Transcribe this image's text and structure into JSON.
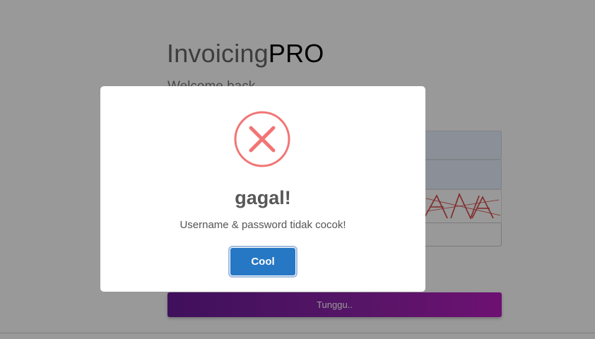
{
  "brand": {
    "prefix": "Invoicing",
    "suffix": "PRO"
  },
  "welcome": "Welcome back",
  "submit_label": "Tunggu..",
  "modal": {
    "icon": "error-x-icon",
    "title": "gagal!",
    "message": "Username & password tidak cocok!",
    "confirm_label": "Cool"
  },
  "colors": {
    "error_red": "#f27474",
    "confirm_blue": "#2778c4",
    "submit_gradient_start": "#6a1b9a",
    "submit_gradient_end": "#b71cbf"
  }
}
